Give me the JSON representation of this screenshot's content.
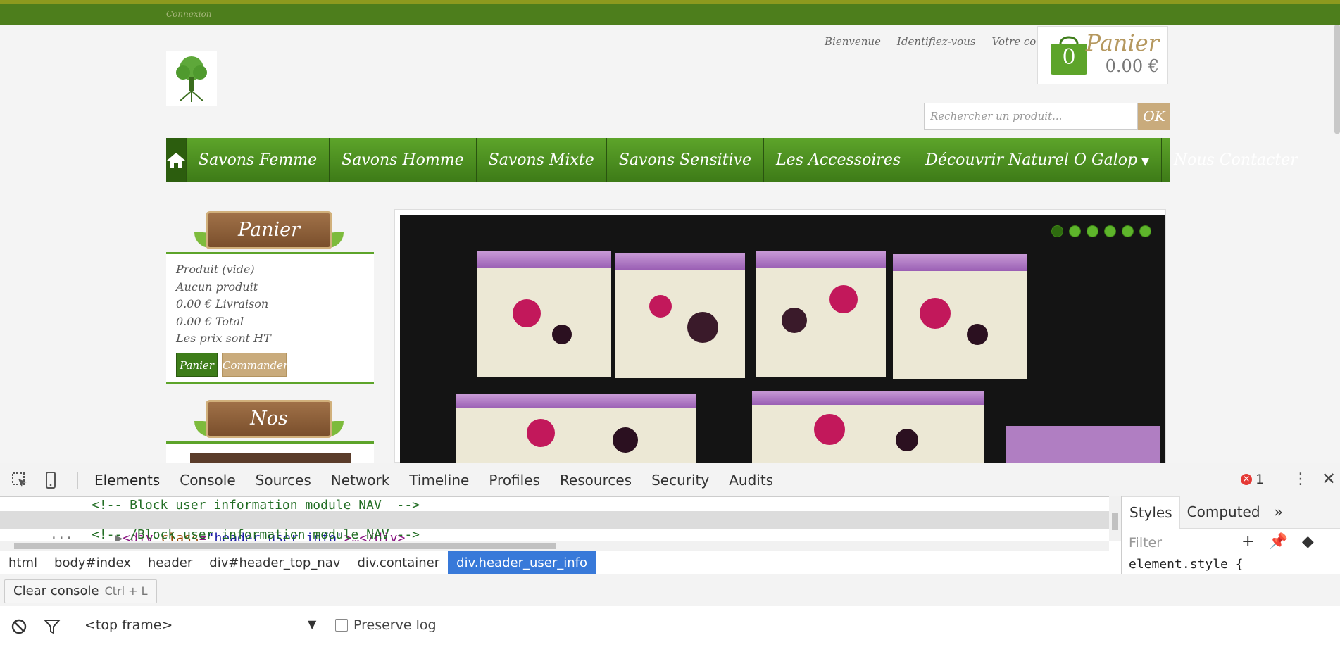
{
  "site": {
    "topnav_login": "Connexion",
    "user_links": [
      "Bienvenue",
      "Identifiez-vous",
      "Votre compte"
    ],
    "cart": {
      "title": "Panier",
      "count": "0",
      "amount": "0.00 €"
    },
    "search": {
      "placeholder": "Rechercher un produit...",
      "button": "OK"
    },
    "menu": {
      "home_icon": "home-icon",
      "items": [
        "Savons Femme",
        "Savons Homme",
        "Savons Mixte",
        "Savons Sensitive",
        "Les Accessoires",
        "Découvrir Naturel O Galop",
        "Nous Contacter"
      ]
    },
    "cart_block": {
      "title": "Panier",
      "lines": [
        "Produit (vide)",
        "Aucun produit",
        "0.00 € Livraison",
        "0.00 € Total",
        "Les prix sont HT"
      ],
      "btn_cart": "Panier",
      "btn_order": "Commander"
    },
    "stores_block": {
      "title": "Nos magasins"
    },
    "slider": {
      "dot_count": 6,
      "active_dot": 0
    },
    "colors": {
      "green": "#4d7e1c",
      "menu_green": "#5da42a",
      "beige": "#c9ab7c",
      "brown": "#8b5a34"
    }
  },
  "devtools": {
    "tabs": [
      "Elements",
      "Console",
      "Sources",
      "Network",
      "Timeline",
      "Profiles",
      "Resources",
      "Security",
      "Audits"
    ],
    "active_tab": "Elements",
    "error_count": "1",
    "dom": {
      "line1": "<!-- Block user information module NAV  -->",
      "line2_tag_open": "<div ",
      "line2_attr": "class",
      "line2_val": "\"header_user_info\"",
      "line2_rest": ">…</div>",
      "line3": "<!-- /Block user information module NAV -->"
    },
    "breadcrumbs": [
      "html",
      "body#index",
      "header",
      "div#header_top_nav",
      "div.container",
      "div.header_user_info"
    ],
    "styles_tabs": [
      "Styles",
      "Computed"
    ],
    "styles_filter": "Filter",
    "element_style": "element.style {",
    "clear_console": "Clear console",
    "clear_shortcut": "Ctrl + L",
    "frame": "<top frame>",
    "preserve_log": "Preserve log"
  }
}
